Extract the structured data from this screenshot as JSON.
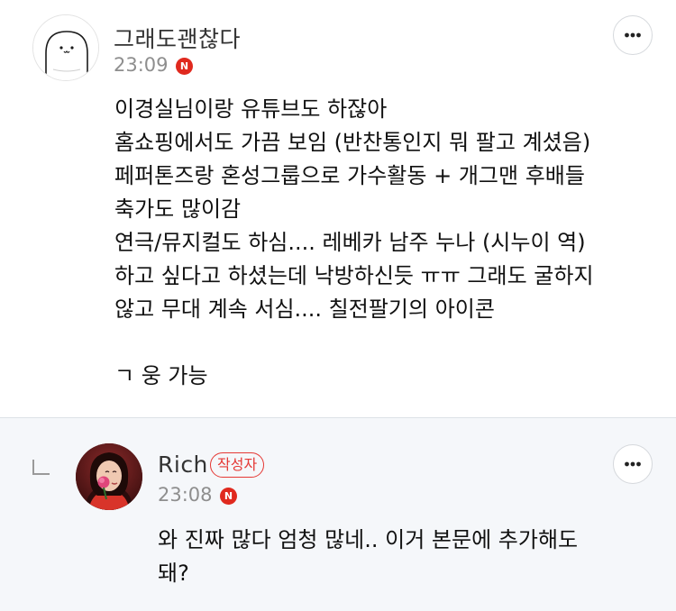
{
  "comments": [
    {
      "nickname": "그래도괜찮다",
      "time": "23:09",
      "new_badge": "N",
      "avatar_icon": "cartoon-face-avatar-icon",
      "more_icon": "more-options-icon",
      "lines": [
        "이경실님이랑 유튜브도 하잖아",
        "홈쇼핑에서도 가끔 보임 (반찬통인지 뭐 팔고 계셨음)",
        "페퍼톤즈랑 혼성그룹으로 가수활동 + 개그맨 후배들",
        "축가도 많이감",
        "연극/뮤지컬도 하심.... 레베카 남주 누나 (시누이 역)",
        "하고 싶다고 하셨는데 낙방하신듯 ㅠㅠ 그래도 굴하지",
        "않고 무대 계속 서심.... 칠전팔기의 아이콘",
        "",
        "ㄱ 웅 가능"
      ]
    },
    {
      "nickname": "Rich",
      "author_badge": "작성자",
      "time": "23:08",
      "new_badge": "N",
      "avatar_icon": "profile-photo-avatar",
      "more_icon": "more-options-icon",
      "reply_icon": "reply-arrow-icon",
      "lines": [
        "와 진짜 많다 엄청 많네.. 이거 본문에 추가해도",
        "돼?"
      ]
    }
  ],
  "colors": {
    "new_badge": "#e0291e",
    "author_badge": "#e53935",
    "reply_background": "#f5f7fa",
    "time_text": "#8e8e8e"
  }
}
